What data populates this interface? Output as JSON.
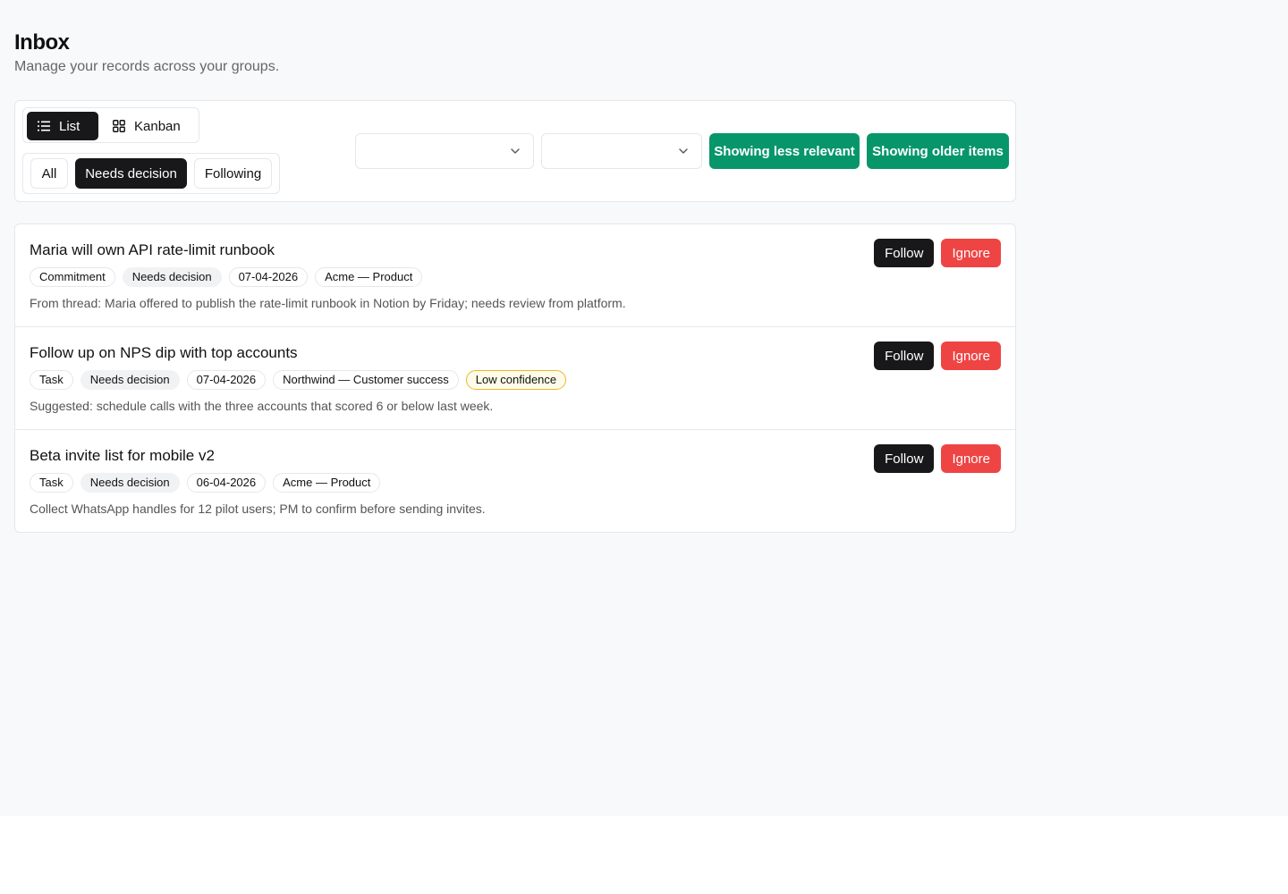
{
  "page": {
    "title": "Inbox",
    "subtitle": "Manage your records across your groups."
  },
  "view_toggle": {
    "list_label": "List",
    "kanban_label": "Kanban",
    "active": "List"
  },
  "filters": {
    "all_label": "All",
    "needs_decision_label": "Needs decision",
    "following_label": "Following",
    "active": "Needs decision"
  },
  "selects": {
    "first_value": "",
    "second_value": ""
  },
  "toolbar_buttons": {
    "less_relevant_label": "Showing less relevant",
    "older_items_label": "Showing older items"
  },
  "colors": {
    "primary_dark": "#18181b",
    "accent_green": "#079669",
    "danger_red": "#ef4444",
    "warning_border": "#e9b92a"
  },
  "items": [
    {
      "title": "Maria will own API rate-limit runbook",
      "type": "Commitment",
      "status": "Needs decision",
      "date": "07-04-2026",
      "group": "Acme — Product",
      "confidence": "",
      "description": "From thread: Maria offered to publish the rate-limit runbook in Notion by Friday; needs review from platform.",
      "follow_label": "Follow",
      "ignore_label": "Ignore"
    },
    {
      "title": "Follow up on NPS dip with top accounts",
      "type": "Task",
      "status": "Needs decision",
      "date": "07-04-2026",
      "group": "Northwind — Customer success",
      "confidence": "Low confidence",
      "description": "Suggested: schedule calls with the three accounts that scored 6 or below last week.",
      "follow_label": "Follow",
      "ignore_label": "Ignore"
    },
    {
      "title": "Beta invite list for mobile v2",
      "type": "Task",
      "status": "Needs decision",
      "date": "06-04-2026",
      "group": "Acme — Product",
      "confidence": "",
      "description": "Collect WhatsApp handles for 12 pilot users; PM to confirm before sending invites.",
      "follow_label": "Follow",
      "ignore_label": "Ignore"
    }
  ]
}
